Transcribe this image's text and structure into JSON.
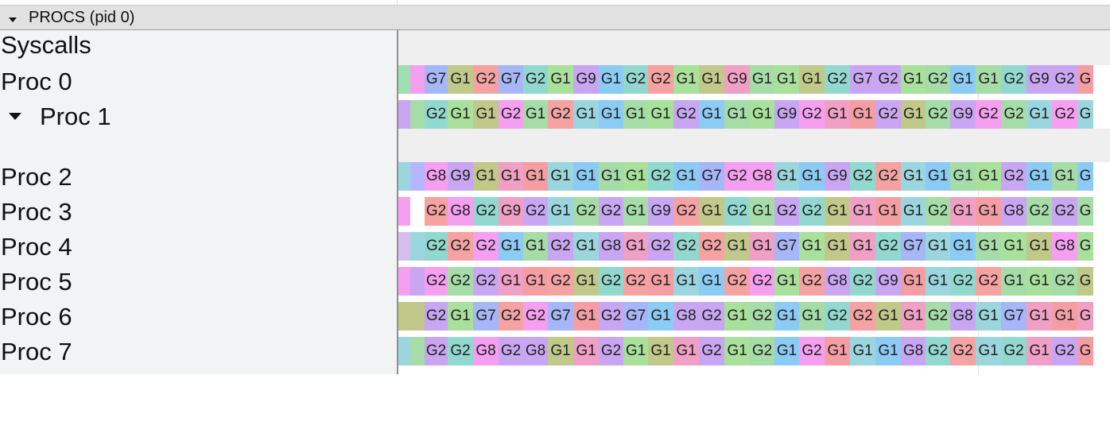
{
  "group": {
    "title": "PROCS (pid 0)"
  },
  "palette": {
    "G1": [
      "#f49ea4",
      "#a9e09b",
      "#9bd6de",
      "#c0c88a",
      "#8ccbf4",
      "#f0a0c4",
      "#a6dca8"
    ],
    "G2": [
      "#c8a6f2",
      "#f59ff1",
      "#92d8cf",
      "#a6dca8",
      "#f4a2a2"
    ],
    "G7": [
      "#a6b6f6",
      "#c9a6f2"
    ],
    "G8": [
      "#f59ff1",
      "#c9a6f2"
    ],
    "G9": [
      "#c8a6f2",
      "#f0a0c4"
    ],
    "lead": [
      "#9fe0b2",
      "#f59ff1",
      "#c8a6f2",
      "#a6dca8",
      "#9bd6de",
      "#b4b7ff",
      "#d8bdf0",
      "#c0c88a",
      "#9fe0c4"
    ]
  },
  "rows": [
    {
      "label": "Syscalls",
      "indent": false,
      "expander": false,
      "lead": [],
      "slices": []
    },
    {
      "label": "Proc 0",
      "indent": false,
      "expander": false,
      "lead": [
        "#9fe0b2",
        "#f59ff1"
      ],
      "slices": [
        "G7",
        "G1",
        "G2",
        "G7",
        "G2",
        "G1",
        "G9",
        "G1",
        "G2",
        "G2",
        "G1",
        "G1",
        "G9",
        "G1",
        "G1",
        "G1",
        "G2",
        "G7",
        "G2",
        "G1",
        "G2",
        "G1",
        "G1",
        "G2",
        "G9",
        "G2",
        "G"
      ]
    },
    {
      "label": "Proc 1",
      "indent": true,
      "expander": true,
      "lead": [
        "#c8a6f2",
        "#a6dca8"
      ],
      "slices": [
        "G2",
        "G1",
        "G1",
        "G2",
        "G1",
        "G2",
        "G1",
        "G1",
        "G1",
        "G1",
        "G2",
        "G1",
        "G1",
        "G1",
        "G9",
        "G2",
        "G1",
        "G1",
        "G2",
        "G1",
        "G2",
        "G9",
        "G2",
        "G2",
        "G1",
        "G2",
        "G"
      ]
    },
    {
      "label": "Proc 2",
      "indent": false,
      "expander": false,
      "lead": [
        "#9bd6de",
        "#b4b7ff"
      ],
      "slices": [
        "G8",
        "G9",
        "G1",
        "G1",
        "G1",
        "G1",
        "G1",
        "G1",
        "G1",
        "G2",
        "G1",
        "G7",
        "G2",
        "G8",
        "G1",
        "G1",
        "G9",
        "G2",
        "G2",
        "G1",
        "G1",
        "G1",
        "G1",
        "G2",
        "G1",
        "G1",
        "G"
      ]
    },
    {
      "label": "Proc 3",
      "indent": false,
      "expander": false,
      "lead": [
        "#f59ff1",
        "#ffffff"
      ],
      "slices": [
        "G2",
        "G8",
        "G2",
        "G9",
        "G2",
        "G1",
        "G2",
        "G2",
        "G1",
        "G9",
        "G2",
        "G1",
        "G2",
        "G1",
        "G2",
        "G2",
        "G1",
        "G1",
        "G1",
        "G1",
        "G2",
        "G1",
        "G1",
        "G8",
        "G2",
        "G2",
        "G"
      ]
    },
    {
      "label": "Proc 4",
      "indent": false,
      "expander": false,
      "lead": [
        "#d8bdf0",
        "#9bd6de"
      ],
      "slices": [
        "G2",
        "G2",
        "G2",
        "G1",
        "G1",
        "G2",
        "G1",
        "G8",
        "G1",
        "G2",
        "G2",
        "G2",
        "G1",
        "G1",
        "G7",
        "G1",
        "G1",
        "G1",
        "G2",
        "G7",
        "G1",
        "G1",
        "G1",
        "G1",
        "G1",
        "G8",
        "G"
      ]
    },
    {
      "label": "Proc 5",
      "indent": false,
      "expander": false,
      "lead": [
        "#f59ff1",
        "#c8a6f2"
      ],
      "slices": [
        "G2",
        "G2",
        "G2",
        "G1",
        "G1",
        "G2",
        "G1",
        "G2",
        "G2",
        "G1",
        "G1",
        "G1",
        "G2",
        "G2",
        "G1",
        "G2",
        "G8",
        "G2",
        "G9",
        "G1",
        "G1",
        "G2",
        "G2",
        "G1",
        "G1",
        "G2",
        "G"
      ]
    },
    {
      "label": "Proc 6",
      "indent": false,
      "expander": false,
      "lead": [
        "#c0c88a",
        "#c0c88a"
      ],
      "slices": [
        "G2",
        "G1",
        "G7",
        "G2",
        "G2",
        "G7",
        "G1",
        "G2",
        "G7",
        "G1",
        "G8",
        "G2",
        "G1",
        "G2",
        "G1",
        "G1",
        "G2",
        "G2",
        "G1",
        "G1",
        "G2",
        "G8",
        "G1",
        "G7",
        "G1",
        "G1",
        "G"
      ]
    },
    {
      "label": "Proc 7",
      "indent": false,
      "expander": false,
      "lead": [
        "#9bd6de",
        "#a6dca8"
      ],
      "slices": [
        "G2",
        "G2",
        "G8",
        "G2",
        "G8",
        "G1",
        "G1",
        "G2",
        "G1",
        "G1",
        "G1",
        "G2",
        "G1",
        "G2",
        "G1",
        "G2",
        "G1",
        "G1",
        "G1",
        "G8",
        "G2",
        "G2",
        "G1",
        "G2",
        "G1",
        "G2",
        "G"
      ]
    }
  ]
}
